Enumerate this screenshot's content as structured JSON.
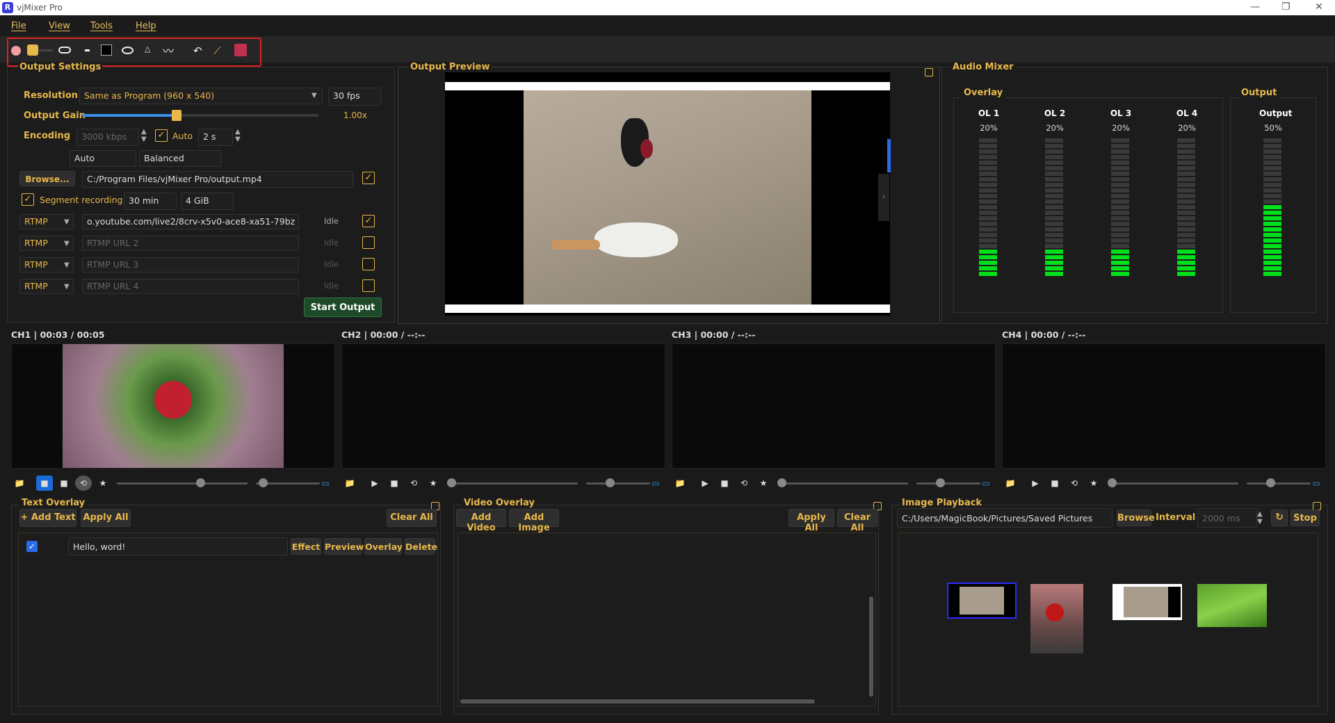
{
  "window": {
    "title": "vjMixer Pro",
    "logo_letter": "R"
  },
  "menu": [
    "File",
    "View",
    "Tools",
    "Help"
  ],
  "output_settings": {
    "title": "Output Settings",
    "resolution_label": "Resolution",
    "resolution_value": "Same as Program (960 x 540)",
    "fps": "30 fps",
    "gain_label": "Output Gain",
    "gain_value": "1.00x",
    "gain_level": 0.4,
    "encoding_label": "Encoding",
    "bitrate": "3000 kbps",
    "auto_label": "Auto",
    "keyframe": "2 s",
    "profile1": "Auto",
    "profile2": "Balanced",
    "browse_label": "Browse...",
    "path": "C:/Program Files/vjMixer Pro/output.mp4",
    "segment_label": "Segment recording",
    "segment_time": "30 min",
    "segment_size": "4 GiB",
    "rtmp_rows": [
      {
        "proto": "RTMP",
        "url": "o.youtube.com/live2/8crv-x5v0-ace8-xa51-79bz",
        "status": "Idle",
        "checked": true,
        "placeholder": false
      },
      {
        "proto": "RTMP",
        "url": "RTMP URL 2",
        "status": "Idle",
        "checked": false,
        "placeholder": true
      },
      {
        "proto": "RTMP",
        "url": "RTMP URL 3",
        "status": "Idle",
        "checked": false,
        "placeholder": true
      },
      {
        "proto": "RTMP",
        "url": "RTMP URL 4",
        "status": "Idle",
        "checked": false,
        "placeholder": true
      }
    ],
    "start_label": "Start Output"
  },
  "preview": {
    "title": "Output Preview"
  },
  "audio": {
    "title": "Audio Mixer",
    "overlay_title": "Overlay",
    "output_title": "Output",
    "channels": [
      {
        "name": "OL 1",
        "pct": "20%",
        "level": 0.2
      },
      {
        "name": "OL 2",
        "pct": "20%",
        "level": 0.2
      },
      {
        "name": "OL 3",
        "pct": "20%",
        "level": 0.2
      },
      {
        "name": "OL 4",
        "pct": "20%",
        "level": 0.2
      }
    ],
    "output": {
      "name": "Output",
      "pct": "50%",
      "level": 0.5
    }
  },
  "channels": [
    {
      "label": "CH1 | 00:03 / 00:05"
    },
    {
      "label": "CH2 | 00:00 / --:--"
    },
    {
      "label": "CH3 | 00:00 / --:--"
    },
    {
      "label": "CH4 | 00:00 / --:--"
    }
  ],
  "text_overlay": {
    "title": "Text Overlay",
    "add": "+ Add Text",
    "apply": "Apply All",
    "clear": "Clear All",
    "item": "Hello, word!",
    "effect": "Effect",
    "preview": "Preview",
    "overlay": "Overlay",
    "delete": "Delete"
  },
  "video_overlay": {
    "title": "Video Overlay",
    "add_video": "Add Video",
    "add_image": "Add Image",
    "apply": "Apply All",
    "clear": "Clear All"
  },
  "image_playback": {
    "title": "Image Playback",
    "path": "C:/Users/MagicBook/Pictures/Saved Pictures",
    "browse": "Browse",
    "interval_label": "Interval",
    "interval": "2000 ms",
    "stop": "Stop"
  }
}
